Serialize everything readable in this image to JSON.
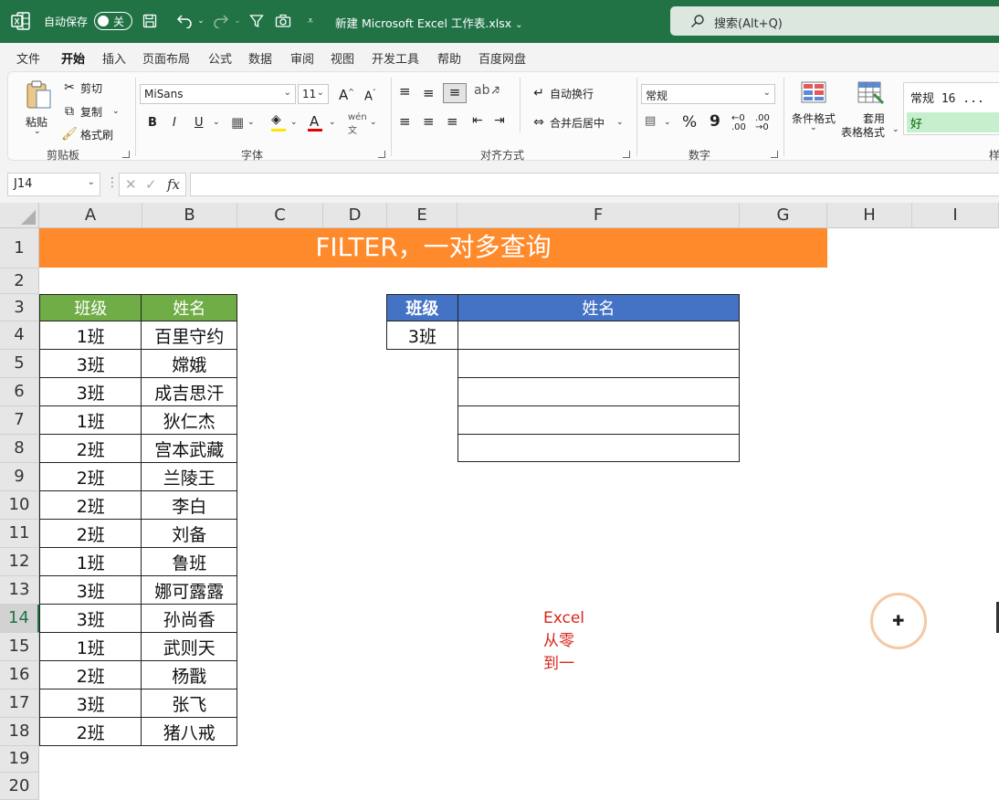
{
  "colors": {
    "brand": "#217346",
    "banner": "#ff8a2b",
    "left_header": "#70ad47",
    "right_header": "#4472c4",
    "watermark": "#d9261c"
  },
  "titlebar": {
    "autosave_label": "自动保存",
    "autosave_state": "关",
    "file_title": "新建 Microsoft Excel 工作表.xlsx",
    "search_placeholder": "搜索(Alt+Q)"
  },
  "menu": [
    "文件",
    "开始",
    "插入",
    "页面布局",
    "公式",
    "数据",
    "审阅",
    "视图",
    "开发工具",
    "帮助",
    "百度网盘"
  ],
  "ribbon": {
    "clipboard": {
      "paste": "粘贴",
      "cut": "剪切",
      "copy": "复制",
      "format_painter": "格式刷",
      "label": "剪贴板"
    },
    "font": {
      "name": "MiSans",
      "size": "11",
      "label": "字体",
      "bold": "B",
      "italic": "I",
      "underline": "U"
    },
    "alignment": {
      "wrap": "自动换行",
      "merge": "合并后居中",
      "label": "对齐方式"
    },
    "number": {
      "format": "常规",
      "label": "数字"
    },
    "styles": {
      "conditional": "条件格式",
      "table1": "套用",
      "table2": "表格格式",
      "style_normal": "常规 16 ...",
      "style_good": "好",
      "label_partial": "样"
    }
  },
  "formula_bar": {
    "name_box": "J14",
    "fx": "fx",
    "value": ""
  },
  "columns": [
    "A",
    "B",
    "C",
    "D",
    "E",
    "F",
    "G",
    "H",
    "I"
  ],
  "rows": [
    "1",
    "2",
    "3",
    "4",
    "5",
    "6",
    "7",
    "8",
    "9",
    "10",
    "11",
    "12",
    "13",
    "14",
    "15",
    "16",
    "17",
    "18",
    "19",
    "20"
  ],
  "active_row": "14",
  "sheet": {
    "banner": "FILTER，一对多查询",
    "source_table": {
      "headers": [
        "班级",
        "姓名"
      ],
      "rows": [
        [
          "1班",
          "百里守约"
        ],
        [
          "3班",
          "嫦娥"
        ],
        [
          "3班",
          "成吉思汗"
        ],
        [
          "1班",
          "狄仁杰"
        ],
        [
          "2班",
          "宫本武藏"
        ],
        [
          "2班",
          "兰陵王"
        ],
        [
          "2班",
          "李白"
        ],
        [
          "2班",
          "刘备"
        ],
        [
          "1班",
          "鲁班"
        ],
        [
          "3班",
          "娜可露露"
        ],
        [
          "3班",
          "孙尚香"
        ],
        [
          "1班",
          "武则天"
        ],
        [
          "2班",
          "杨戬"
        ],
        [
          "3班",
          "张飞"
        ],
        [
          "2班",
          "猪八戒"
        ]
      ]
    },
    "lookup_table": {
      "headers": [
        "班级",
        "姓名"
      ],
      "class_value": "3班",
      "results": [
        "",
        "",
        "",
        "",
        ""
      ]
    },
    "watermark": "Excel从零到一"
  }
}
